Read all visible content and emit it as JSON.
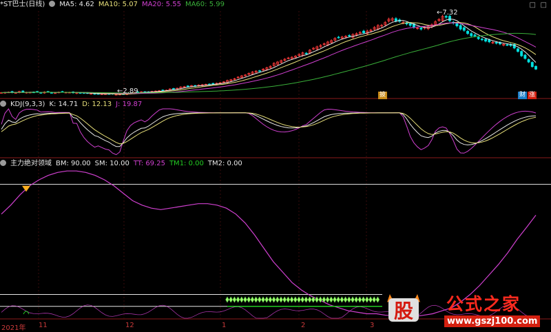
{
  "colors": {
    "background": "#000000",
    "ma5": "#e8e8e8",
    "ma10": "#e8e07a",
    "ma20": "#d040d0",
    "ma60": "#3ab03a",
    "candle_up": "#ff3b3b",
    "candle_down": "#00e0e0",
    "axis": "#8b1a1a",
    "k": "#e8e8e8",
    "d": "#e8e07a",
    "j": "#d040d0",
    "bm": "#e8e8e8",
    "sm": "#e8e8e8",
    "tt": "#d040d0",
    "tm1": "#22cc22",
    "tm2": "#e8e8e8"
  },
  "price_panel": {
    "stock": "*ST巴士(日线)",
    "ma5_label": "MA5: 4.62",
    "ma10_label": "MA10: 5.07",
    "ma20_label": "MA20: 5.55",
    "ma60_label": "MA60: 5.99",
    "high_marker": "7.32",
    "low_marker": "2.89",
    "tag_pi": "披",
    "tag_cai": "财",
    "tag_zhang": "涨",
    "corner_left": "□",
    "corner_right": "□"
  },
  "kdj_panel": {
    "title": "KDJ(9,3,3)",
    "k_label": "K: 14.71",
    "d_label": "D: 12.13",
    "j_label": "J: 19.87"
  },
  "indicator_panel": {
    "title": "主力绝对领域",
    "bm_label": "BM: 90.00",
    "sm_label": "SM: 10.00",
    "tt_label": "TT: 69.25",
    "tm1_label": "TM1: 0.00",
    "tm2_label": "TM2: 0.00"
  },
  "x_axis": {
    "labels": [
      "2021年",
      "11",
      "12",
      "1",
      "2",
      "3"
    ]
  },
  "watermark": {
    "seal": "股",
    "title": "公式之家",
    "url": "www.gszj100.com"
  },
  "chart_data": [
    {
      "type": "candlestick",
      "title": "*ST巴士(日线)",
      "n_bars": 150,
      "close": [
        2.99,
        3.0,
        3.02,
        2.99,
        2.99,
        3.06,
        3.01,
        3.01,
        3.01,
        3.02,
        3.02,
        2.97,
        3.03,
        3.03,
        2.99,
        2.98,
        3.02,
        3.03,
        3.01,
        3.01,
        2.98,
        3.0,
        2.98,
        2.96,
        2.95,
        2.94,
        2.91,
        2.93,
        2.92,
        2.92,
        2.92,
        2.91,
        2.89,
        2.9,
        2.92,
        2.96,
        2.96,
        3.0,
        3.02,
        3.04,
        3.01,
        3.03,
        3.06,
        3.08,
        3.1,
        3.12,
        3.13,
        3.2,
        3.22,
        3.24,
        3.31,
        3.33,
        3.36,
        3.39,
        3.35,
        3.42,
        3.44,
        3.46,
        3.47,
        3.49,
        3.52,
        3.55,
        3.6,
        3.68,
        3.72,
        3.78,
        3.87,
        3.94,
        3.99,
        4.08,
        4.16,
        4.21,
        4.21,
        4.32,
        4.4,
        4.48,
        4.65,
        4.72,
        4.8,
        4.88,
        4.95,
        4.99,
        5.05,
        5.15,
        5.24,
        5.21,
        5.39,
        5.5,
        5.58,
        5.66,
        5.75,
        5.85,
        5.93,
        6.05,
        6.11,
        6.13,
        6.17,
        6.19,
        6.27,
        6.32,
        6.39,
        6.37,
        6.47,
        6.52,
        6.67,
        6.78,
        6.79,
        6.95,
        7.14,
        7.17,
        7.04,
        7.02,
        6.95,
        6.87,
        6.79,
        6.68,
        6.64,
        6.58,
        6.68,
        6.73,
        6.82,
        6.99,
        7.12,
        7.3,
        7.25,
        7.05,
        6.92,
        6.76,
        6.58,
        6.51,
        6.33,
        6.2,
        6.19,
        6.04,
        5.98,
        5.9,
        5.86,
        5.83,
        5.78,
        5.74,
        5.72,
        5.69,
        5.65,
        5.51,
        5.32,
        5.07,
        4.92,
        4.72,
        4.46,
        4.32
      ],
      "ma_labels": {
        "MA5": 4.62,
        "MA10": 5.07,
        "MA20": 5.55,
        "MA60": 5.99
      },
      "annotations": [
        {
          "text": "7.32",
          "kind": "high"
        },
        {
          "text": "2.89",
          "kind": "low"
        }
      ]
    },
    {
      "type": "line",
      "title": "KDJ(9,3,3)",
      "series": [
        {
          "name": "K",
          "last": 14.71
        },
        {
          "name": "D",
          "last": 12.13
        },
        {
          "name": "J",
          "last": 19.87
        }
      ]
    },
    {
      "type": "line",
      "title": "主力绝对领域",
      "series": [
        {
          "name": "BM",
          "values_constant": 90.0
        },
        {
          "name": "SM",
          "values_constant": 10.0
        },
        {
          "name": "TT",
          "last": 69.25,
          "values": [
            70,
            76,
            83,
            89,
            93,
            96,
            98,
            99,
            99,
            98,
            96,
            93,
            89,
            84,
            79,
            76,
            74,
            73,
            74,
            75,
            76,
            77,
            77,
            76,
            74,
            70,
            64,
            56,
            47,
            38,
            31,
            24,
            19,
            15,
            12,
            9,
            7,
            5,
            4,
            3,
            3,
            2,
            2,
            1,
            1,
            2,
            3,
            5,
            7,
            11,
            16,
            22,
            29,
            36,
            44,
            53,
            61,
            69.25
          ]
        },
        {
          "name": "TM1",
          "last": 0.0
        },
        {
          "name": "TM2",
          "last": 0.0
        }
      ]
    }
  ]
}
